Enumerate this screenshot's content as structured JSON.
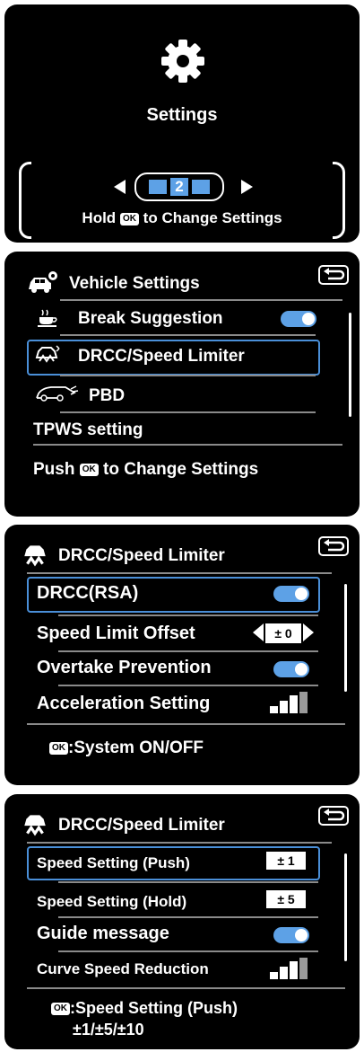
{
  "panel1": {
    "title": "Settings",
    "page_number": "2",
    "hint_prefix": "Hold",
    "ok_label": "OK",
    "hint_suffix": "to Change Settings",
    "icon": "gear-icon"
  },
  "panel2": {
    "title": "Vehicle Settings",
    "items": [
      {
        "label": "Break Suggestion",
        "icon": "coffee-cup-icon",
        "toggle": "on"
      },
      {
        "label": "DRCC/Speed Limiter",
        "icon": "drcc-icon",
        "selected": true
      },
      {
        "label": "PBD",
        "icon": "car-door-icon"
      },
      {
        "label": "TPWS setting"
      }
    ],
    "footer_prefix": "Push",
    "ok_label": "OK",
    "footer_suffix": "to Change Settings"
  },
  "panel3": {
    "title": "DRCC/Speed Limiter",
    "items": [
      {
        "label": "DRCC(RSA)",
        "toggle": "on",
        "selected": true
      },
      {
        "label": "Speed Limit Offset",
        "value": "± 0"
      },
      {
        "label": "Overtake Prevention",
        "toggle": "on"
      },
      {
        "label": "Acceleration Setting",
        "level": 3
      }
    ],
    "ok_label": "OK",
    "footer": ":System ON/OFF"
  },
  "panel4": {
    "title": "DRCC/Speed Limiter",
    "items": [
      {
        "label": "Speed Setting (Push)",
        "value": "± 1",
        "selected": true
      },
      {
        "label": "Speed Setting (Hold)",
        "value": "± 5"
      },
      {
        "label": "Guide message",
        "toggle": "on"
      },
      {
        "label": "Curve Speed Reduction",
        "level": 3
      }
    ],
    "ok_label": "OK",
    "footer_line1": ":Speed Setting (Push)",
    "footer_line2": "±1/±5/±10"
  },
  "colors": {
    "accent": "#5da1e6",
    "selection": "#4a8fd8",
    "background": "#000000",
    "text": "#ffffff"
  }
}
